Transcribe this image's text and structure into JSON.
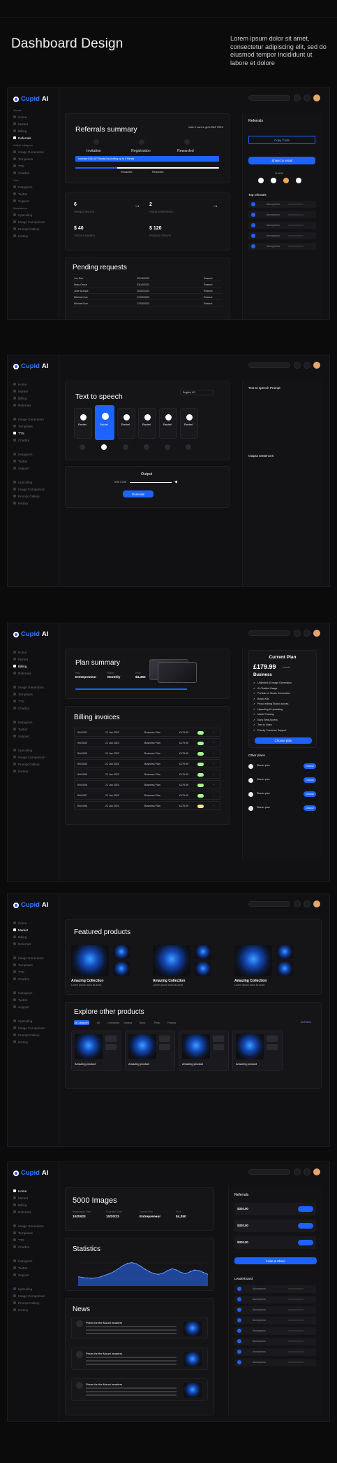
{
  "header": {
    "title": "Dashboard Design",
    "lorem": "Lorem ipsum dolor sit amet, consectetur adipiscing elit, sed do eiusmod tempor incididunt ut labore et dolore"
  },
  "app": {
    "logo_prefix": "Cupid",
    "logo_suffix": "AI"
  },
  "sidebar": {
    "section_general": "General",
    "general_items": [
      "Home",
      "Market",
      "Billing",
      "Referrals"
    ],
    "section_ai": "Artificial Intelligence",
    "ai_items": [
      "Image Generation",
      "Templates",
      "TTS",
      "Chatbot"
    ],
    "section_tools": "Tools",
    "tool_items": [
      "Instagram",
      "Twitter",
      "Support"
    ],
    "section_other": "Miscellaneous",
    "other_items": [
      "Upscaling",
      "Image Comparison",
      "Prompt Gallery",
      "History"
    ]
  },
  "screen1": {
    "title": "Referrals summary",
    "steps": [
      "Invitation",
      "Registration",
      "Rewarded"
    ],
    "note": "Invite 5 more to get 120AP FREE",
    "banner": "Increase $150 AP Reward by inviting up to 5 friends",
    "milestones": [
      "Rewarded",
      "Rewarded"
    ],
    "stats": [
      {
        "value": "6",
        "label": "FRIENDS INVITED"
      },
      {
        "value": "2",
        "label": "FRIENDS REFERRED"
      },
      {
        "value": "$ 40",
        "label": "CREDITS EARNED"
      },
      {
        "value": "$ 120",
        "label": "PENDING CREDITS"
      }
    ],
    "pending_title": "Pending requests",
    "pending": [
      {
        "name": "Joe Doe",
        "date": "02/13/2023",
        "action": "Resend"
      },
      {
        "name": "Mary Grace",
        "date": "03/10/2023",
        "action": "Resend"
      },
      {
        "name": "Jane Durape",
        "date": "10/02/2023",
        "action": "Resend"
      },
      {
        "name": "Michael Coe",
        "date": "17/03/2023",
        "action": "Resend"
      },
      {
        "name": "Michael Doe",
        "date": "17/03/2023",
        "action": "Resend"
      }
    ],
    "panel_title": "Referrals",
    "panel_btn": "Share by email",
    "panel_copy": "Copy Code",
    "panel_share": "SHARE",
    "top_title": "Top referrals",
    "top_rows": [
      "Anonymous",
      "Anonymous",
      "Anonymous",
      "Anonymous",
      "Anonymous"
    ]
  },
  "screen2": {
    "title": "Text to speech",
    "lang": "English US",
    "voices": [
      "Rachel",
      "Rachel",
      "Rachel",
      "Rachel",
      "Rachel",
      "Rachel"
    ],
    "output": "Output",
    "time": "0:00 / 1:00",
    "generate": "Generate",
    "panel_title": "Text to speech Prompt",
    "panel_out": "Output sentences"
  },
  "screen3": {
    "title": "Plan summary",
    "plan_labels": [
      "Plan",
      "Billing",
      "Price"
    ],
    "plan_values": [
      "Entrepreneur",
      "Monthly",
      "$4,350"
    ],
    "invoices_title": "Billing invoices",
    "invoices": [
      {
        "id": "INV1001",
        "date": "21 Jan 2023",
        "plan": "Business Plan",
        "amt": "£179.99"
      },
      {
        "id": "INV1002",
        "date": "21 Jan 2023",
        "plan": "Business Plan",
        "amt": "£179.99"
      },
      {
        "id": "INV1003",
        "date": "21 Jan 2023",
        "plan": "Business Plan",
        "amt": "£179.99"
      },
      {
        "id": "INV1004",
        "date": "21 Jan 2023",
        "plan": "Business Plan",
        "amt": "£179.99"
      },
      {
        "id": "INV1005",
        "date": "21 Jan 2023",
        "plan": "Business Plan",
        "amt": "£179.99"
      },
      {
        "id": "INV1006",
        "date": "21 Jan 2023",
        "plan": "Business Plan",
        "amt": "£179.99"
      },
      {
        "id": "INV1007",
        "date": "21 Jan 2023",
        "plan": "Business Plan",
        "amt": "£179.99"
      },
      {
        "id": "INV1008",
        "date": "21 Jan 2023",
        "plan": "Business Plan",
        "amt": "£179.99"
      }
    ],
    "current_plan": "Current Plan",
    "price": "£179.99",
    "per": "/month",
    "plan_name": "Business",
    "features": [
      "Unlimited AI Image Generation",
      "AI Chatbot Usage",
      "Portfolio & Studio Generation",
      "Brand Kits",
      "Photo editing Studio access",
      "Upscaling & Upscaling",
      "Model Training",
      "Early Beta Access",
      "Text to Video",
      "Priority Customer Support"
    ],
    "choose": "Choose plan",
    "other_plans": "Other plans",
    "plan_rows": [
      "Starter plan",
      "Starter plan",
      "Starter plan",
      "Starter plan"
    ],
    "choose_small": "Choose"
  },
  "screen4": {
    "featured_title": "Featured products",
    "featured": [
      {
        "title": "Amazing Collection",
        "desc": "Lorem ipsum dolor sit amet"
      },
      {
        "title": "Amazing Collection",
        "desc": "Lorem ipsum dolor sit amet"
      },
      {
        "title": "Amazing Collection",
        "desc": "Lorem ipsum dolor sit amet"
      }
    ],
    "explore_title": "Explore other products",
    "filters": [
      "All Categories",
      "Art",
      "Collectibles",
      "Gaming",
      "Music",
      "Photo",
      "Portfolio"
    ],
    "filter_all": "All Filters",
    "products": [
      "Amazing product",
      "Amazing product",
      "Amazing product",
      "Amazing product"
    ]
  },
  "screen5": {
    "images_count": "5000 Images",
    "summary_labels": [
      "Registration Date",
      "Expiration Date",
      "Current Plan",
      "Price"
    ],
    "summary_values": [
      "10/20/23",
      "10/20/23",
      "Entrepreneur",
      "$4,350"
    ],
    "stats_title": "Statistics",
    "news_title": "News",
    "news": [
      {
        "title": "Prices for the Mount invaders"
      },
      {
        "title": "Prices for the Mount invaders"
      },
      {
        "title": "Prices for the Mount invaders"
      }
    ],
    "referrals_title": "Referrals",
    "codes": [
      "$320.00",
      "$320.00",
      "$320.00"
    ],
    "invite": "Invite & Share",
    "leaderboard": "Leaderboard",
    "lb_rows": [
      "Anonymous",
      "Anonymous",
      "Anonymous",
      "Anonymous",
      "Anonymous",
      "Anonymous",
      "Anonymous",
      "Anonymous"
    ]
  },
  "chart_data": {
    "type": "area",
    "x": [
      1,
      2,
      3,
      4,
      5,
      6,
      7,
      8,
      9,
      10,
      11,
      12,
      13,
      14,
      15,
      16,
      17,
      18,
      19,
      20,
      21,
      22,
      23,
      24,
      25,
      26,
      27,
      28,
      29,
      30
    ],
    "values": [
      30,
      28,
      26,
      25,
      26,
      30,
      35,
      40,
      47,
      56,
      66,
      73,
      76,
      72,
      64,
      54,
      46,
      40,
      38,
      42,
      50,
      56,
      52,
      44,
      40,
      46,
      52,
      50,
      44,
      38
    ],
    "color": "#2a6dff"
  }
}
